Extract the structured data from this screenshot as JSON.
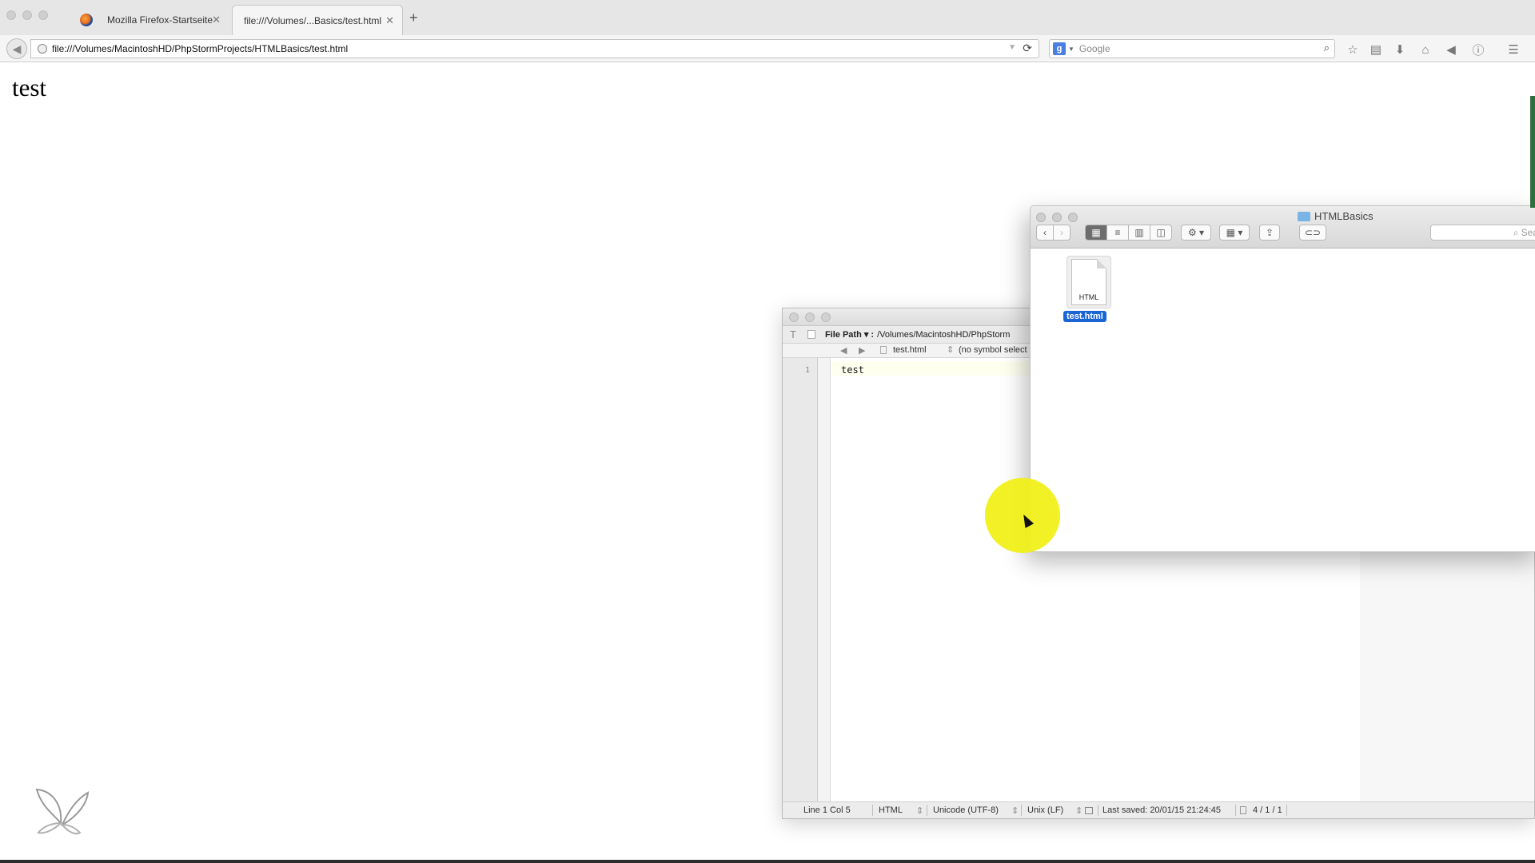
{
  "browser": {
    "tabs": [
      {
        "label": "Mozilla Firefox-Startseite",
        "active": false
      },
      {
        "label": "file:///Volumes/...Basics/test.html",
        "active": true
      }
    ],
    "url": "file:///Volumes/MacintoshHD/PhpStormProjects/HTMLBasics/test.html",
    "search_placeholder": "Google",
    "page_text": "test",
    "icons": [
      "back-icon",
      "reload-icon",
      "search-icon",
      "bookmark-star-icon",
      "reading-list-icon",
      "download-icon",
      "home-icon",
      "send-icon",
      "info-icon",
      "menu-icon"
    ]
  },
  "editor": {
    "toolbar": {
      "file_path_label": "File Path ▾ :",
      "file_path_value": "/Volumes/MacintoshHD/PhpStorm"
    },
    "nav": {
      "file": "test.html",
      "symbol": "(no symbol select"
    },
    "line_number": "1",
    "code": "test",
    "status": {
      "position": "Line 1 Col 5",
      "syntax": "HTML",
      "encoding": "Unicode (UTF-8)",
      "line_endings": "Unix (LF)",
      "last_saved": "Last saved: 20/01/15 21:24:45",
      "counts": "4 / 1 / 1"
    }
  },
  "finder": {
    "title": "HTMLBasics",
    "search_placeholder": "Sea",
    "file": {
      "name": "test.html",
      "type_label": "HTML"
    }
  }
}
